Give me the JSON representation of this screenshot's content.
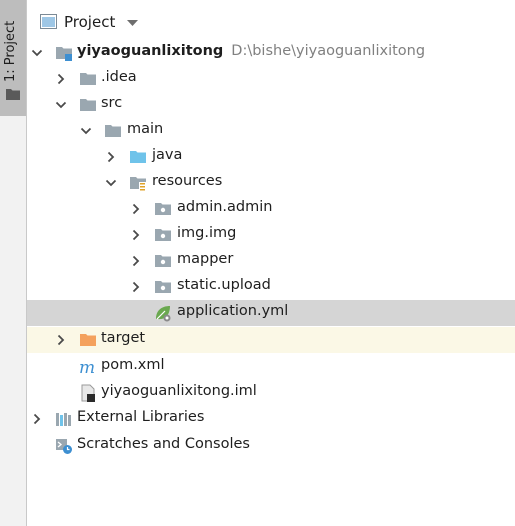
{
  "stripe": {
    "tab_label": "1: Project"
  },
  "header": {
    "title": "Project"
  },
  "tree": {
    "root": {
      "name": "yiyaoguanlixitong",
      "path": "D:\\bishe\\yiyaoguanlixitong"
    },
    "idea": ".idea",
    "src": "src",
    "main": "main",
    "java": "java",
    "resources": "resources",
    "admin": "admin.admin",
    "img": "img.img",
    "mapper": "mapper",
    "static": "static.upload",
    "application": "application.yml",
    "target": "target",
    "pom": "pom.xml",
    "iml": "yiyaoguanlixitong.iml",
    "external": "External Libraries",
    "scratches": "Scratches and Consoles"
  },
  "colors": {
    "folder_gray": "#9aa7b0",
    "folder_blue": "#6fc3ea",
    "folder_orange": "#f4a15d",
    "selection": "#d5d5d5",
    "excluded_bg": "#fbf8e6",
    "maven_blue": "#3d8fd1",
    "spring_green": "#6aa84f"
  }
}
